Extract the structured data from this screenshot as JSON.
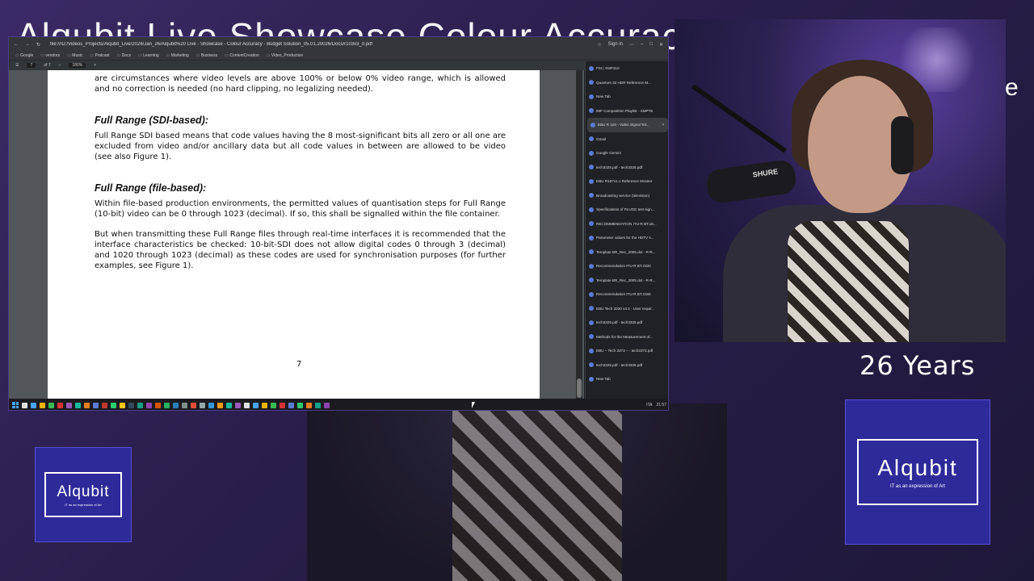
{
  "overlay": {
    "stream_title": "Alqubit Live Showcase Colour Accuracy",
    "partial_letter": "e",
    "years_text": "26 Years"
  },
  "logos": {
    "name": "Alqubit",
    "tagline": "IT as an expression of Art"
  },
  "browser": {
    "url": "file:///D:/Videos_Projects/Alqubit_Live/2026/Jan_26/Alqubit%20 Live - Showcase - Colour Accuracy - Budget Solution_05.01.20026/Docs/r103v3_0.pdf",
    "sign_in": "Sign in",
    "bookmarks": [
      "Google",
      "vendors",
      "Music",
      "Podcast",
      "Docs",
      "Learning",
      "Marketing",
      "Business",
      "ContentCreation",
      "Video_Production"
    ],
    "page_current": "7",
    "page_total": "of 7",
    "zoom": "180%"
  },
  "pdf": {
    "intro": "are circumstances where video levels are above 100% or below 0% video range, which is allowed and no correction is needed (no hard clipping, no legalizing needed).",
    "h_sdi": "Full Range (SDI-based):",
    "p_sdi": "Full Range SDI based means that code values having the 8 most-significant bits all zero or all one are excluded from video and/or ancillary data but all code values in between are allowed to be video (see also Figure 1).",
    "h_file": "Full Range (file-based):",
    "p_file1": "Within file-based production environments, the permitted values of quantisation steps for Full Range (10-bit) video can be 0 through 1023 (decimal). If so, this shall be signalled within the file container.",
    "p_file2": "But when transmitting these Full Range files through real-time interfaces it is recommended that the interface characteristics be checked: 10-bit-SDI does not allow digital codes 0 through 3 (decimal) and 1020 through 1023 (decimal) as these codes are used for synchronisation purposes (for further examples, see Figure 1).",
    "page_number": "7"
  },
  "tabs": [
    "FSI | XMP310",
    "Quantum 32 HDR Reference M...",
    "New Tab",
    "IMF Composition Playlist - SMPTE",
    "EBU R 103 - Video Signal Tol...",
    "Gmail",
    "Google Gemini",
    "tech3325.pdf - tech3325.pdf",
    "EBU R167v1.1 Reference Monitor",
    "Broadcasting service (television)",
    "Specifications of PLUGE test sign...",
    "RECOMMENDATION ITU-R BT.18...",
    "Parameter values for the HDTV s...",
    "Template BR_Rec_2005.dot - R-R...",
    "Recommendation ITU-R BT.2100",
    "Template BR_Rec_2005.dot - R-R...",
    "Recommendation ITU-R BT.2166",
    "EBU Tech 3320 v4.1 - User requir...",
    "tech3325.pdf - tech3325.pdf",
    "Methods for the Measurement of...",
    "EBU – Tech 3373 – - tech3373.pdf",
    "tech3325.pdf - tech3325.pdf",
    "New Tab"
  ],
  "active_tab_index": 4,
  "mic_brand": "SHURE",
  "taskbar": {
    "lang": "ITA",
    "time": "21:57"
  }
}
